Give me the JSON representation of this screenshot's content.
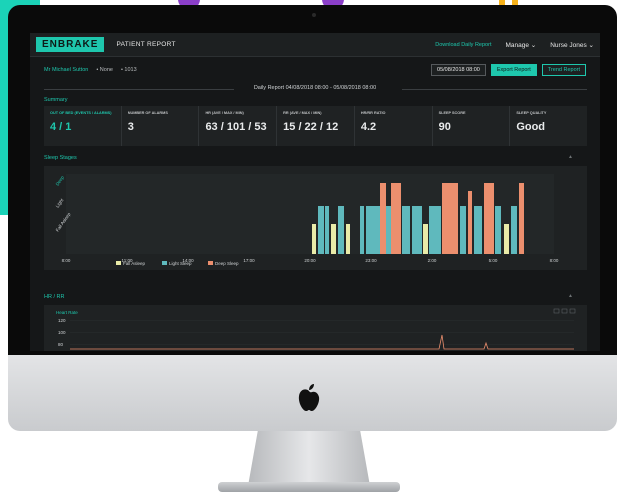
{
  "app": {
    "logo": "ENBRAKE",
    "title": "PATIENT REPORT",
    "download_link": "Download Daily Report",
    "manage_menu": "Manage",
    "user_menu": "Nurse Jones",
    "chevron": "⌄"
  },
  "patient": {
    "name": "Mr Michael Sutton",
    "room": "• None",
    "bed": "• 1013",
    "date_value": "05/08/2018 08:00",
    "export_label": "Export Report",
    "trend_label": "Trend Report"
  },
  "report": {
    "daily_label": "Daily Report 04/08/2018 08:00 - 05/08/2018 08:00"
  },
  "summary": {
    "title": "Summary",
    "cards": [
      {
        "label": "OUT OF BED (Events / Alarms)",
        "value": "4 / 1"
      },
      {
        "label": "NUMBER OF ALARMS",
        "value": "3"
      },
      {
        "label": "HR (Ave / Max / Min)",
        "value": "63 / 101 / 53"
      },
      {
        "label": "RR (Ave / Max / Min)",
        "value": "15 / 22 / 12"
      },
      {
        "label": "HR/RR RATIO",
        "value": "4.2"
      },
      {
        "label": "SLEEP SCORE",
        "value": "90"
      },
      {
        "label": "SLEEP QUALITY",
        "value": "Good"
      }
    ]
  },
  "sleep_stages": {
    "title": "Sleep Stages",
    "y_labels": [
      "Deep",
      "Light",
      "Fall Asleep"
    ],
    "x_labels": [
      "8:00",
      "11:00",
      "14:00",
      "17:00",
      "20:00",
      "23:00",
      "2:00",
      "5:00",
      "8:00"
    ],
    "legend": [
      {
        "label": "Fall Asleep",
        "color": "#e9eba8"
      },
      {
        "label": "Light Sleep",
        "color": "#5fb9bd"
      },
      {
        "label": "Deep Sleep",
        "color": "#ec8f6e"
      }
    ],
    "colors": {
      "fall_asleep": "#e9eba8",
      "light_sleep": "#5fb9bd",
      "deep_sleep": "#ec8f6e"
    }
  },
  "hr_rr": {
    "title": "HR / RR",
    "series_label": "Heart Rate",
    "y_ticks": [
      "120",
      "100",
      "80"
    ]
  },
  "colors": {
    "accent": "#1ec7ad",
    "background": "#151718",
    "panel": "#1f2223"
  }
}
